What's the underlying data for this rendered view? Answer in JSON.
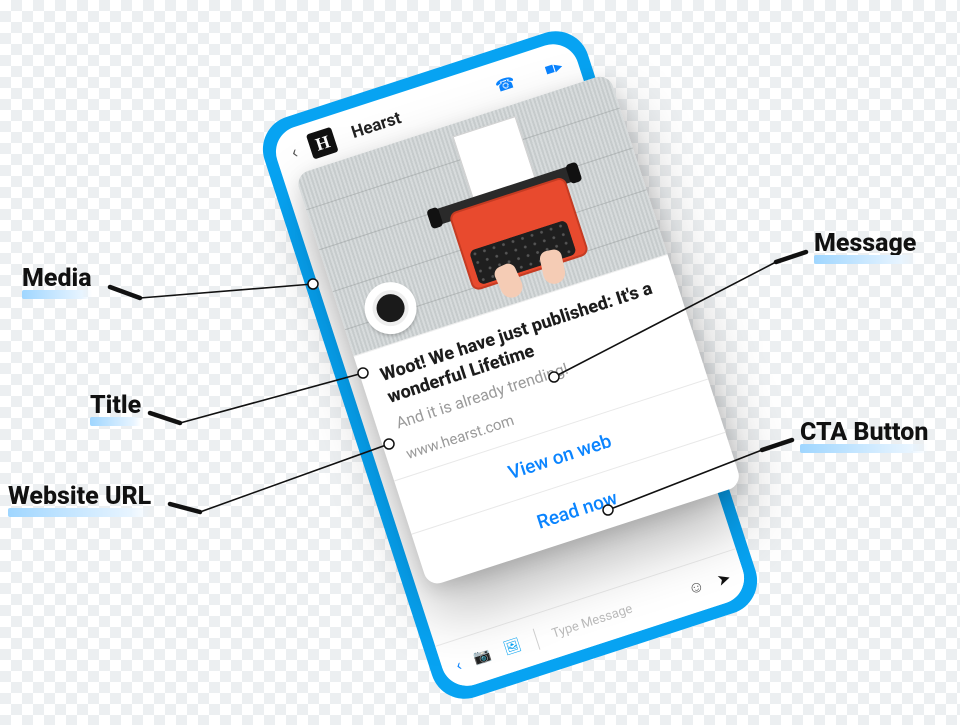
{
  "labels": {
    "media": "Media",
    "title": "Title",
    "url": "Website URL",
    "message": "Message",
    "cta": "CTA Button"
  },
  "phone": {
    "brand": "Hearst",
    "input_placeholder": "Type Message"
  },
  "card": {
    "title": "Woot! We have just published: It's a wonderful Lifetime",
    "message": "And it is already trending!",
    "url": "www.hearst.com",
    "cta1": "View on web",
    "cta2": "Read now"
  }
}
